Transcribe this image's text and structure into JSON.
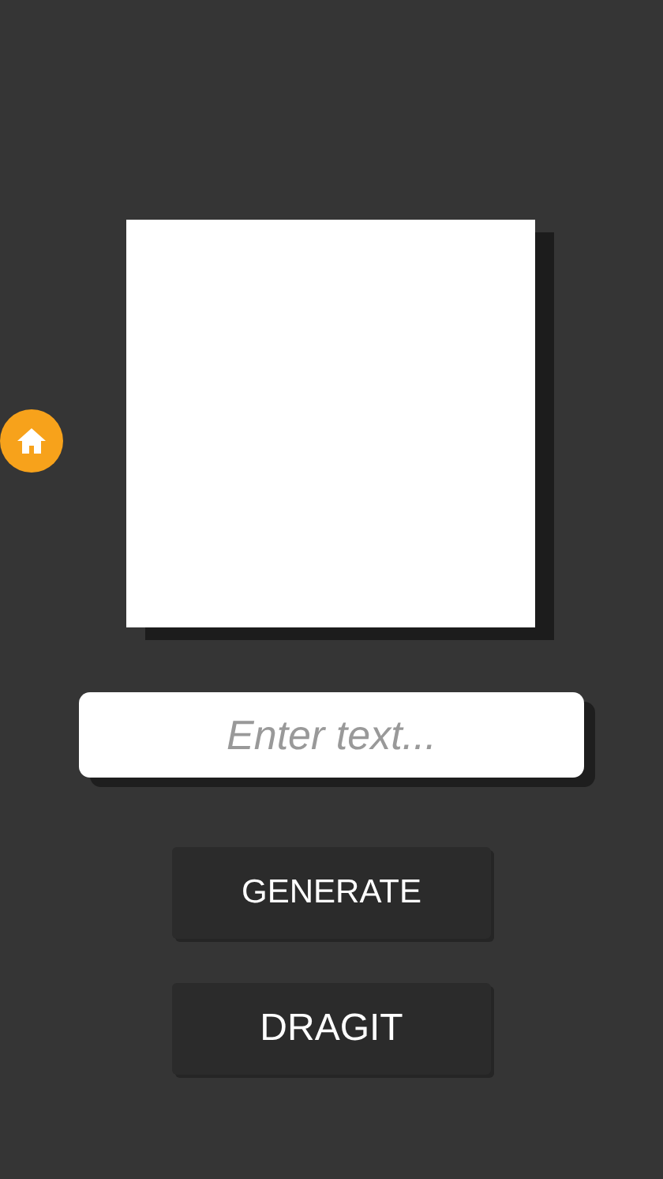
{
  "input": {
    "placeholder": "Enter text..."
  },
  "buttons": [
    {
      "label": "GENERATE"
    },
    {
      "label": "DRAGIT"
    }
  ]
}
